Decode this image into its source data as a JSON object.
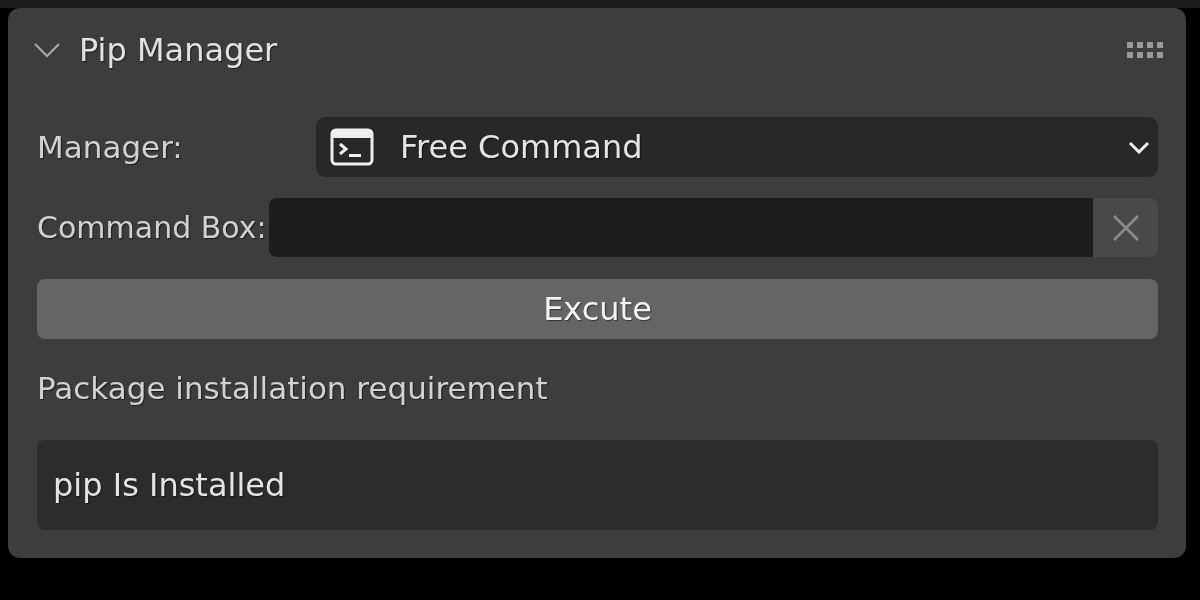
{
  "panel": {
    "title": "Pip Manager",
    "expanded": true
  },
  "manager": {
    "label": "Manager:",
    "value": "Free Command"
  },
  "command_box": {
    "label": "Command Box:"
  },
  "execute_button": {
    "label": "Excute"
  },
  "requirement": {
    "label": "Package installation requirement",
    "status": "pip Is Installed"
  }
}
